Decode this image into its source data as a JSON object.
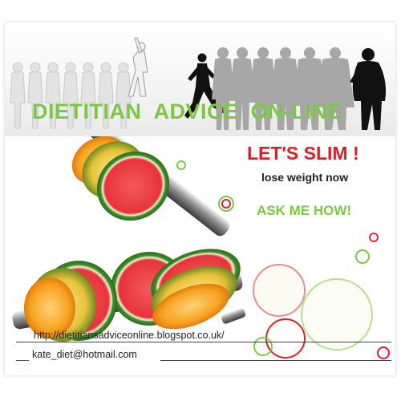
{
  "banner": {
    "title": "DIETITIAN  ADVICE  ON-LINE"
  },
  "promo": {
    "headline": "LET'S SLIM !",
    "subline": "lose weight now",
    "cta": "ASK ME HOW!"
  },
  "contact": {
    "url": "http://dietitiansadviceonline.blogspot.co.uk/",
    "email": "kate_diet@hotmail.com",
    "email_prefix": "__"
  },
  "colors": {
    "green": "#7ac943",
    "red": "#d71f2a",
    "orange": "#f7941d",
    "watermelon_red": "#e8323c",
    "rind": "#3e8f2a"
  }
}
